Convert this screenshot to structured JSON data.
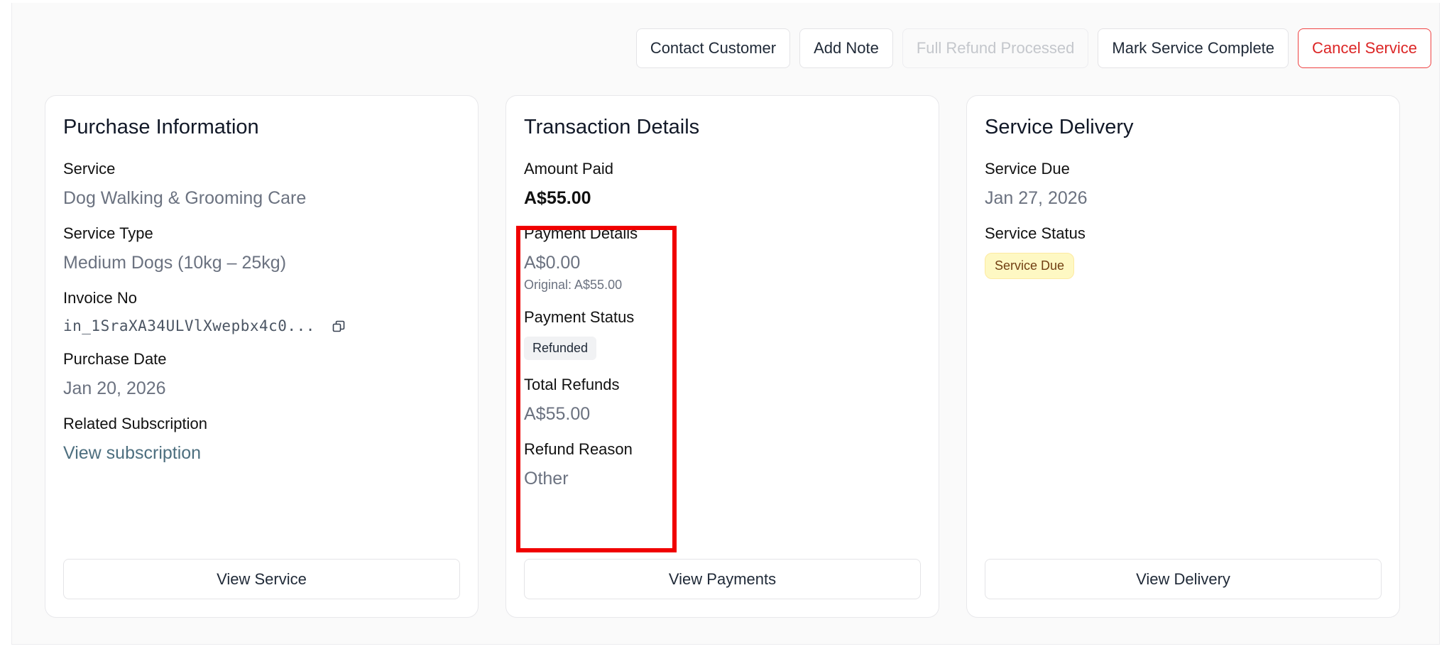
{
  "actions": {
    "contact_customer": "Contact Customer",
    "add_note": "Add Note",
    "full_refund": "Full Refund Processed",
    "mark_complete": "Mark Service Complete",
    "cancel_service": "Cancel Service"
  },
  "purchase": {
    "title": "Purchase Information",
    "service_label": "Service",
    "service_value": "Dog Walking & Grooming Care",
    "type_label": "Service Type",
    "type_value": "Medium Dogs (10kg – 25kg)",
    "invoice_label": "Invoice No",
    "invoice_value": "in_1SraXA34ULVlXwepbx4c0...",
    "date_label": "Purchase Date",
    "date_value": "Jan 20, 2026",
    "subscription_label": "Related Subscription",
    "subscription_link": "View subscription",
    "button": "View Service"
  },
  "transaction": {
    "title": "Transaction Details",
    "amount_label": "Amount Paid",
    "amount_value": "A$55.00",
    "payment_details_label": "Payment Details",
    "payment_details_value": "A$0.00",
    "payment_details_original": "Original: A$55.00",
    "payment_status_label": "Payment Status",
    "payment_status_value": "Refunded",
    "total_refunds_label": "Total Refunds",
    "total_refunds_value": "A$55.00",
    "refund_reason_label": "Refund Reason",
    "refund_reason_value": "Other",
    "button": "View Payments"
  },
  "delivery": {
    "title": "Service Delivery",
    "due_label": "Service Due",
    "due_value": "Jan 27, 2026",
    "status_label": "Service Status",
    "status_value": "Service Due",
    "button": "View Delivery"
  },
  "colors": {
    "highlight": "#f00000",
    "danger": "#dc2626",
    "link": "#4d6f7f",
    "status_due_bg": "#fef8c3"
  },
  "icons": {
    "invoice_copy": "copy-icon"
  }
}
